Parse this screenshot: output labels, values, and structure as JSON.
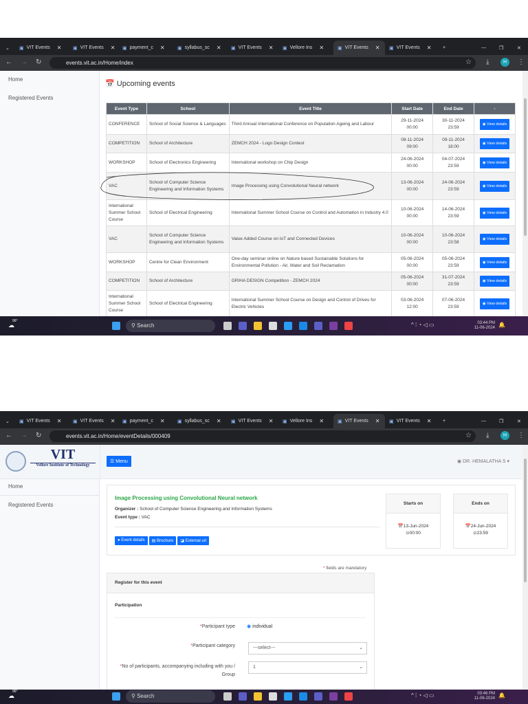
{
  "browser": {
    "tabs": [
      "VIT Events",
      "VIT Events",
      "payment_c",
      "syllabus_sc",
      "VIT Events",
      "Vellore Ins",
      "VIT Events",
      "VIT Events"
    ],
    "active_tab": 6,
    "new_tab": "+",
    "avatar_letter": "H"
  },
  "screen1": {
    "url": "events.vit.ac.in/Home/index",
    "sidebar": {
      "items": [
        "Home",
        "Registered Events"
      ]
    },
    "heading": "Upcoming events",
    "table": {
      "headers": [
        "Event Type",
        "School",
        "Event Title",
        "Start Date",
        "End Date",
        "-"
      ],
      "button_label": "View details",
      "rows": [
        {
          "type": "CONFERENCE",
          "school": "School of Social Science & Languages",
          "title": "Third Annual International Conference on Population Ageing and Labour",
          "start": "29-11-2024",
          "start_time": "00:00",
          "end": "30-11-2024",
          "end_time": "23:59"
        },
        {
          "type": "COMPETITION",
          "school": "School of Architecture",
          "title": "ZEMCH 2024 - Logo Design Contest",
          "start": "08-11-2024",
          "start_time": "09:00",
          "end": "09-11-2024",
          "end_time": "18:00"
        },
        {
          "type": "WORKSHOP",
          "school": "School of Electronics Engineering",
          "title": "International workshop on Chip Design",
          "start": "24-06-2024",
          "start_time": "00:00",
          "end": "04-07-2024",
          "end_time": "23:59"
        },
        {
          "type": "VAC",
          "school": "School of Computer Science Engineering and Information Systems",
          "title": "Image Processing using Convolutional Neural network",
          "start": "13-06-2024",
          "start_time": "00:00",
          "end": "24-06-2024",
          "end_time": "23:59",
          "circled": true
        },
        {
          "type": "International Summer School Course",
          "school": "School of Electrical Engineering",
          "title": "International Summer School Course on Control and Automation in Industry 4.0",
          "start": "10-06-2024",
          "start_time": "00:00",
          "end": "14-06-2024",
          "end_time": "23:59"
        },
        {
          "type": "VAC",
          "school": "School of Computer Science Engineering and Information Systems",
          "title": "Value Added Course on IoT and Connected Devices",
          "start": "10-06-2024",
          "start_time": "00:00",
          "end": "10-06-2024",
          "end_time": "23:58"
        },
        {
          "type": "WORKSHOP",
          "school": "Centre for Clean Environment",
          "title": "One-day seminar online on Nature based Sustainable Solutions for Environmental Pollution - Air, Water and Soil Reclamation",
          "start": "05-06-2024",
          "start_time": "00:00",
          "end": "05-06-2024",
          "end_time": "23:59"
        },
        {
          "type": "COMPETITION",
          "school": "School of Architecture",
          "title": "GRIHA DESIGN Competition - ZEMCH 2024",
          "start": "05-06-2024",
          "start_time": "00:00",
          "end": "31-07-2024",
          "end_time": "23:59"
        },
        {
          "type": "International Summer School Course",
          "school": "School of Electrical Engineering",
          "title": "International Summer School Course on Design and Control of Drives for Electric Vehicles",
          "start": "03-06-2024",
          "start_time": "12:00",
          "end": "07-06-2024",
          "end_time": "23:59"
        }
      ]
    },
    "taskbar": {
      "weather": "96°",
      "search": "Search",
      "time": "03:44 PM",
      "date": "11-06-2024"
    }
  },
  "screen2": {
    "url": "events.vit.ac.in/Home/eventDetails/000409",
    "logo": {
      "title": "VIT",
      "subtitle": "Vellore Institute of Technology"
    },
    "menu_label": "Menu",
    "user": "DR. HEMALATHA S",
    "sidebar": {
      "items": [
        "Home",
        "Registered Events"
      ]
    },
    "event": {
      "title": "Image Processing using Convolutional Neural network",
      "organizer_label": "Organizer :",
      "organizer": "School of Computer Science Engineering and Information Systems",
      "type_label": "Event type :",
      "type": "VAC",
      "buttons": [
        "Event details",
        "Brochure",
        "External url"
      ],
      "starts_label": "Starts on",
      "start_date": "13-Jun-2024",
      "start_time": "00:00",
      "ends_label": "Ends on",
      "end_date": "24-Jun-2024",
      "end_time": "23:59"
    },
    "mandatory_note": "fields are mandatory",
    "register": {
      "header": "Register for this event",
      "section": "Participation",
      "fields": [
        {
          "label": "Participant type",
          "value": "individual"
        },
        {
          "label": "Participant category",
          "value": "---select---"
        },
        {
          "label": "No of participants, accompanying including with you / Group",
          "value": "1"
        }
      ]
    },
    "taskbar": {
      "weather": "96°",
      "search": "Search",
      "time": "03:46 PM",
      "date": "11-06-2024"
    }
  },
  "colors": {
    "primary": "#0d6efd",
    "title_green": "#28a745",
    "table_header": "#5f6670"
  }
}
